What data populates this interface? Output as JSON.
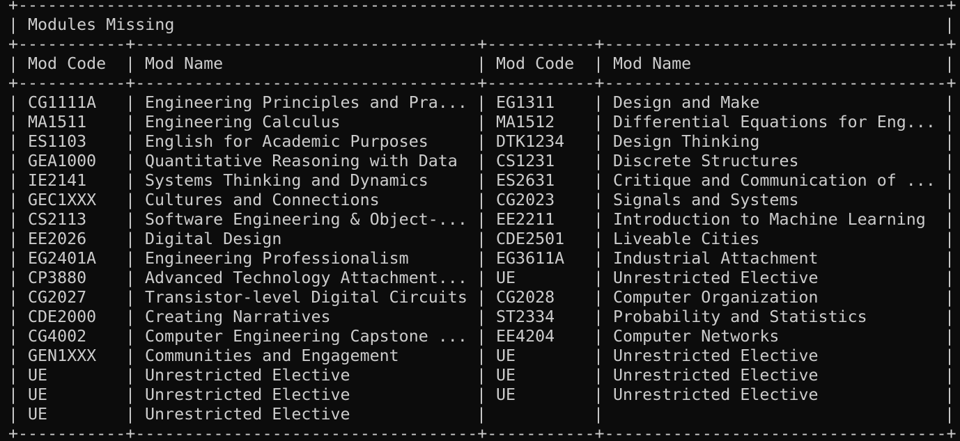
{
  "table": {
    "title": "Modules Missing",
    "headers": [
      "Mod Code",
      "Mod Name",
      "Mod Code",
      "Mod Name"
    ],
    "rows": [
      [
        "CG1111A",
        "Engineering Principles and Pra...",
        "EG1311",
        "Design and Make"
      ],
      [
        "MA1511",
        "Engineering Calculus",
        "MA1512",
        "Differential Equations for Eng..."
      ],
      [
        "ES1103",
        "English for Academic Purposes",
        "DTK1234",
        "Design Thinking"
      ],
      [
        "GEA1000",
        "Quantitative Reasoning with Data",
        "CS1231",
        "Discrete Structures"
      ],
      [
        "IE2141",
        "Systems Thinking and Dynamics",
        "ES2631",
        "Critique and Communication of ..."
      ],
      [
        "GEC1XXX",
        "Cultures and Connections",
        "CG2023",
        "Signals and Systems"
      ],
      [
        "CS2113",
        "Software Engineering & Object-...",
        "EE2211",
        "Introduction to Machine Learning"
      ],
      [
        "EE2026",
        "Digital Design",
        "CDE2501",
        "Liveable Cities"
      ],
      [
        "EG2401A",
        "Engineering Professionalism",
        "EG3611A",
        "Industrial Attachment"
      ],
      [
        "CP3880",
        "Advanced Technology Attachment...",
        "UE",
        "Unrestricted Elective"
      ],
      [
        "CG2027",
        "Transistor-level Digital Circuits",
        "CG2028",
        "Computer Organization"
      ],
      [
        "CDE2000",
        "Creating Narratives",
        "ST2334",
        "Probability and Statistics"
      ],
      [
        "CG4002",
        "Computer Engineering Capstone ...",
        "EE4204",
        "Computer Networks"
      ],
      [
        "GEN1XXX",
        "Communities and Engagement",
        "UE",
        "Unrestricted Elective"
      ],
      [
        "UE",
        "Unrestricted Elective",
        "UE",
        "Unrestricted Elective"
      ],
      [
        "UE",
        "Unrestricted Elective",
        "UE",
        "Unrestricted Elective"
      ],
      [
        "UE",
        "Unrestricted Elective",
        "",
        ""
      ]
    ]
  },
  "colors": {
    "background": "#0c0c0c",
    "text": "#cccccc"
  }
}
